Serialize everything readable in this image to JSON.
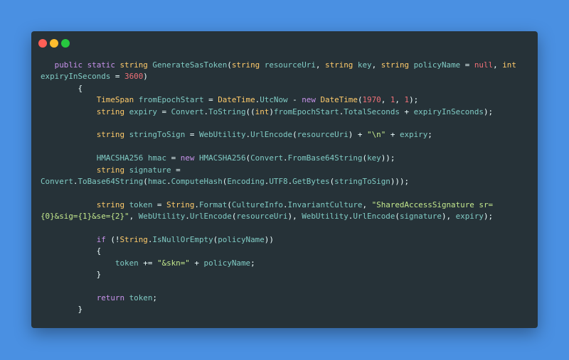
{
  "colors": {
    "background": "#4a90e2",
    "window": "#263238",
    "close": "#ff5f56",
    "minimize": "#ffbd2e",
    "maximize": "#27c93f",
    "keyword": "#c792ea",
    "type": "#ffcb6b",
    "identifier": "#80cbc4",
    "string": "#c3e88d",
    "number": "#f07178"
  },
  "window_controls": [
    "close",
    "minimize",
    "maximize"
  ],
  "code_lines": [
    [
      [
        "p",
        "   "
      ],
      [
        "k",
        "public"
      ],
      [
        "p",
        " "
      ],
      [
        "k",
        "static"
      ],
      [
        "p",
        " "
      ],
      [
        "t",
        "string"
      ],
      [
        "i",
        " GenerateSasToken"
      ],
      [
        "p",
        "("
      ],
      [
        "t",
        "string"
      ],
      [
        "i",
        " resourceUri"
      ],
      [
        "p",
        ", "
      ],
      [
        "t",
        "string"
      ],
      [
        "i",
        " key"
      ],
      [
        "p",
        ", "
      ],
      [
        "t",
        "string"
      ],
      [
        "i",
        " policyName"
      ],
      [
        "p",
        " = "
      ],
      [
        "n",
        "null"
      ],
      [
        "p",
        ", "
      ],
      [
        "t",
        "int"
      ]
    ],
    [
      [
        "i",
        "expiryInSeconds"
      ],
      [
        "p",
        " = "
      ],
      [
        "n",
        "3600"
      ],
      [
        "p",
        ")"
      ]
    ],
    [
      [
        "p",
        "        {"
      ]
    ],
    [
      [
        "p",
        "            "
      ],
      [
        "t",
        "TimeSpan"
      ],
      [
        "i",
        " fromEpochStart"
      ],
      [
        "p",
        " = "
      ],
      [
        "t",
        "DateTime"
      ],
      [
        "p",
        "."
      ],
      [
        "i",
        "UtcNow"
      ],
      [
        "p",
        " - "
      ],
      [
        "k",
        "new"
      ],
      [
        "p",
        " "
      ],
      [
        "t",
        "DateTime"
      ],
      [
        "p",
        "("
      ],
      [
        "n",
        "1970"
      ],
      [
        "p",
        ", "
      ],
      [
        "n",
        "1"
      ],
      [
        "p",
        ", "
      ],
      [
        "n",
        "1"
      ],
      [
        "p",
        ");"
      ]
    ],
    [
      [
        "p",
        "            "
      ],
      [
        "t",
        "string"
      ],
      [
        "i",
        " expiry"
      ],
      [
        "p",
        " = "
      ],
      [
        "i",
        "Convert"
      ],
      [
        "p",
        "."
      ],
      [
        "i",
        "ToString"
      ],
      [
        "p",
        "(("
      ],
      [
        "t",
        "int"
      ],
      [
        "p",
        ")"
      ],
      [
        "i",
        "fromEpochStart"
      ],
      [
        "p",
        "."
      ],
      [
        "i",
        "TotalSeconds"
      ],
      [
        "p",
        " + "
      ],
      [
        "i",
        "expiryInSeconds"
      ],
      [
        "p",
        ");"
      ]
    ],
    [],
    [
      [
        "p",
        "            "
      ],
      [
        "t",
        "string"
      ],
      [
        "i",
        " stringToSign"
      ],
      [
        "p",
        " = "
      ],
      [
        "i",
        "WebUtility"
      ],
      [
        "p",
        "."
      ],
      [
        "i",
        "UrlEncode"
      ],
      [
        "p",
        "("
      ],
      [
        "i",
        "resourceUri"
      ],
      [
        "p",
        ") + "
      ],
      [
        "s",
        "\"\\n\""
      ],
      [
        "p",
        " + "
      ],
      [
        "i",
        "expiry"
      ],
      [
        "p",
        ";"
      ]
    ],
    [],
    [
      [
        "p",
        "            "
      ],
      [
        "i",
        "HMACSHA256"
      ],
      [
        "i",
        " hmac"
      ],
      [
        "p",
        " = "
      ],
      [
        "k",
        "new"
      ],
      [
        "p",
        " "
      ],
      [
        "i",
        "HMACSHA256"
      ],
      [
        "p",
        "("
      ],
      [
        "i",
        "Convert"
      ],
      [
        "p",
        "."
      ],
      [
        "i",
        "FromBase64String"
      ],
      [
        "p",
        "("
      ],
      [
        "i",
        "key"
      ],
      [
        "p",
        "));"
      ]
    ],
    [
      [
        "p",
        "            "
      ],
      [
        "t",
        "string"
      ],
      [
        "i",
        " signature"
      ],
      [
        "p",
        " ="
      ]
    ],
    [
      [
        "i",
        "Convert"
      ],
      [
        "p",
        "."
      ],
      [
        "i",
        "ToBase64String"
      ],
      [
        "p",
        "("
      ],
      [
        "i",
        "hmac"
      ],
      [
        "p",
        "."
      ],
      [
        "i",
        "ComputeHash"
      ],
      [
        "p",
        "("
      ],
      [
        "i",
        "Encoding"
      ],
      [
        "p",
        "."
      ],
      [
        "i",
        "UTF8"
      ],
      [
        "p",
        "."
      ],
      [
        "i",
        "GetBytes"
      ],
      [
        "p",
        "("
      ],
      [
        "i",
        "stringToSign"
      ],
      [
        "p",
        ")));"
      ]
    ],
    [],
    [
      [
        "p",
        "            "
      ],
      [
        "t",
        "string"
      ],
      [
        "i",
        " token"
      ],
      [
        "p",
        " = "
      ],
      [
        "t",
        "String"
      ],
      [
        "p",
        "."
      ],
      [
        "i",
        "Format"
      ],
      [
        "p",
        "("
      ],
      [
        "i",
        "CultureInfo"
      ],
      [
        "p",
        "."
      ],
      [
        "i",
        "InvariantCulture"
      ],
      [
        "p",
        ", "
      ],
      [
        "s",
        "\"SharedAccessSignature sr="
      ]
    ],
    [
      [
        "s",
        "{0}&sig={1}&se={2}\""
      ],
      [
        "p",
        ", "
      ],
      [
        "i",
        "WebUtility"
      ],
      [
        "p",
        "."
      ],
      [
        "i",
        "UrlEncode"
      ],
      [
        "p",
        "("
      ],
      [
        "i",
        "resourceUri"
      ],
      [
        "p",
        "), "
      ],
      [
        "i",
        "WebUtility"
      ],
      [
        "p",
        "."
      ],
      [
        "i",
        "UrlEncode"
      ],
      [
        "p",
        "("
      ],
      [
        "i",
        "signature"
      ],
      [
        "p",
        "), "
      ],
      [
        "i",
        "expiry"
      ],
      [
        "p",
        ");"
      ]
    ],
    [],
    [
      [
        "p",
        "            "
      ],
      [
        "k",
        "if"
      ],
      [
        "p",
        " (!"
      ],
      [
        "t",
        "String"
      ],
      [
        "p",
        "."
      ],
      [
        "i",
        "IsNullOrEmpty"
      ],
      [
        "p",
        "("
      ],
      [
        "i",
        "policyName"
      ],
      [
        "p",
        "))"
      ]
    ],
    [
      [
        "p",
        "            {"
      ]
    ],
    [
      [
        "p",
        "                "
      ],
      [
        "i",
        "token"
      ],
      [
        "p",
        " += "
      ],
      [
        "s",
        "\"&skn=\""
      ],
      [
        "p",
        " + "
      ],
      [
        "i",
        "policyName"
      ],
      [
        "p",
        ";"
      ]
    ],
    [
      [
        "p",
        "            }"
      ]
    ],
    [],
    [
      [
        "p",
        "            "
      ],
      [
        "k",
        "return"
      ],
      [
        "p",
        " "
      ],
      [
        "i",
        "token"
      ],
      [
        "p",
        ";"
      ]
    ],
    [
      [
        "p",
        "        }"
      ]
    ]
  ]
}
